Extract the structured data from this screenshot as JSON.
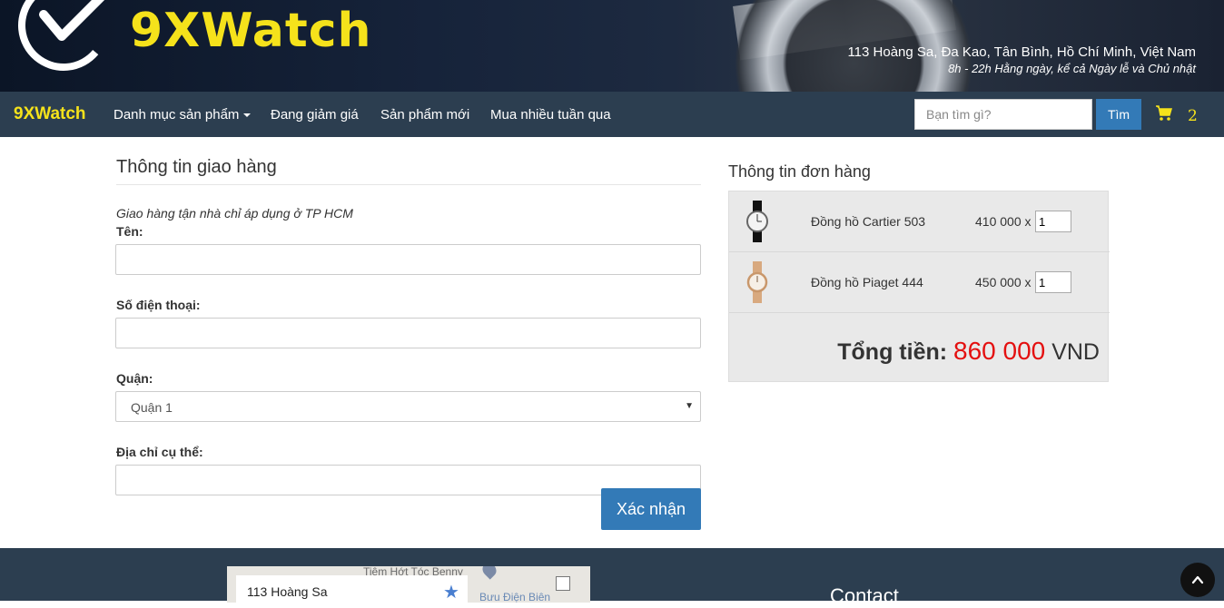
{
  "banner": {
    "brand": "9XWatch",
    "address": "113 Hoàng Sa, Đa Kao, Tân Bình, Hồ Chí Minh, Việt Nam",
    "hours": "8h - 22h Hằng ngày, kể cả Ngày lễ và Chủ nhật"
  },
  "nav": {
    "brand": "9XWatch",
    "items": [
      {
        "label": "Danh mục sản phẩm"
      },
      {
        "label": "Đang giảm giá"
      },
      {
        "label": "Sản phẩm mới"
      },
      {
        "label": "Mua nhiều tuần qua"
      }
    ],
    "search_placeholder": "Bạn tìm gì?",
    "search_button": "Tìm",
    "cart_count": "2",
    "colors": {
      "bar": "#2c3e50",
      "brand": "#f5e21b",
      "primary": "#337ab7"
    }
  },
  "shipping": {
    "title": "Thông tin giao hàng",
    "note": "Giao hàng tận nhà chỉ áp dụng ở TP HCM",
    "name_label": "Tên:",
    "name_value": "",
    "phone_label": "Số điện thoại:",
    "phone_value": "",
    "district_label": "Quận:",
    "district_selected": "Quận 1",
    "address_label": "Địa chỉ cụ thể:",
    "address_value": "",
    "submit": "Xác nhận"
  },
  "order": {
    "title": "Thông tin đơn hàng",
    "items": [
      {
        "name": "Đồng hồ Cartier 503",
        "price": "410 000 x",
        "qty": "1",
        "icon": "black-strap-watch"
      },
      {
        "name": "Đồng hồ Piaget 444",
        "price": "450 000 x",
        "qty": "1",
        "icon": "gold-bracelet-watch"
      }
    ],
    "total_label": "Tổng tiền:",
    "total_value": "860 000",
    "total_currency": "VND",
    "colors": {
      "total": "#e41010"
    }
  },
  "footer": {
    "map_address": "113 Hoàng Sa",
    "map_poi": "Tiệm Hớt Tóc Benny",
    "map_poi2": "Bưu Điện Biên",
    "contact_heading": "Contact"
  }
}
